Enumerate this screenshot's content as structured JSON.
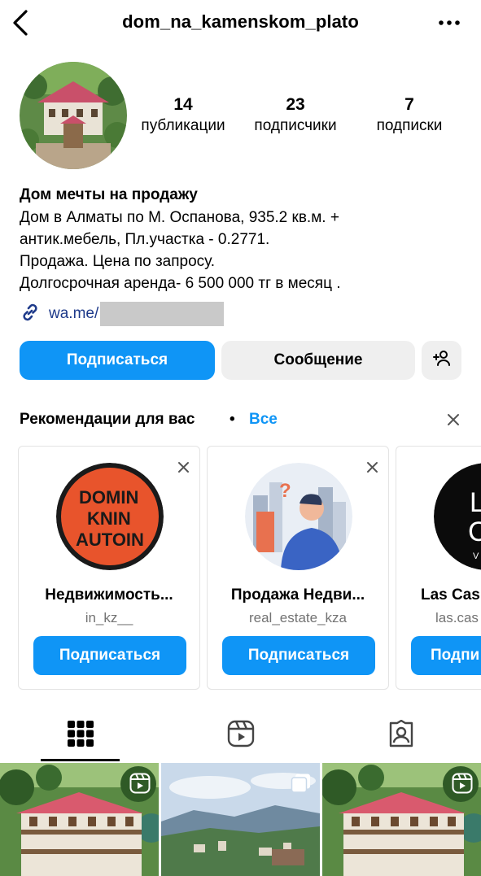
{
  "header": {
    "username": "dom_na_kamenskom_plato",
    "back_icon": "chevron-left-icon",
    "more_icon": "more-horizontal-icon"
  },
  "stats": [
    {
      "count": "14",
      "label": "публикации"
    },
    {
      "count": "23",
      "label": "подписчики"
    },
    {
      "count": "7",
      "label": "подписки"
    }
  ],
  "bio": {
    "name": "Дом мечты на продажу",
    "lines": [
      "Дом в Алматы по М. Оспанова, 935.2 кв.м. +",
      "антик.мебель, Пл.участка - 0.2771.",
      "Продажа. Цена по запросу.",
      "Долгосрочная аренда- 6 500 000 тг в месяц ."
    ],
    "link_text": "wa.me/"
  },
  "actions": {
    "follow_label": "Подписаться",
    "message_label": "Сообщение",
    "add_user_icon": "add-user-icon"
  },
  "recommendations": {
    "title": "Рекомендации для вас",
    "separator": "•",
    "see_all": "Все",
    "cards": [
      {
        "name": "Недвижимость...",
        "username": "in_kz__",
        "button": "Подписаться",
        "logo_lines": [
          "DOMIN",
          "KNIN",
          "AUTOIN"
        ]
      },
      {
        "name": "Продажа Недви...",
        "username": "real_estate_kza",
        "button": "Подписаться"
      },
      {
        "name": "Las Cas",
        "username": "las.cas",
        "button": "Подпи",
        "logo_lines": [
          "La",
          "Ca",
          "VILL"
        ]
      }
    ]
  },
  "tabs": [
    {
      "name": "grid",
      "icon": "grid-icon",
      "active": true
    },
    {
      "name": "reels",
      "icon": "reels-icon",
      "active": false
    },
    {
      "name": "tagged",
      "icon": "tagged-user-icon",
      "active": false
    }
  ],
  "colors": {
    "accent": "#0f95f6",
    "button_gray": "#efefef",
    "link": "#1e3a8a",
    "muted": "#737373"
  }
}
